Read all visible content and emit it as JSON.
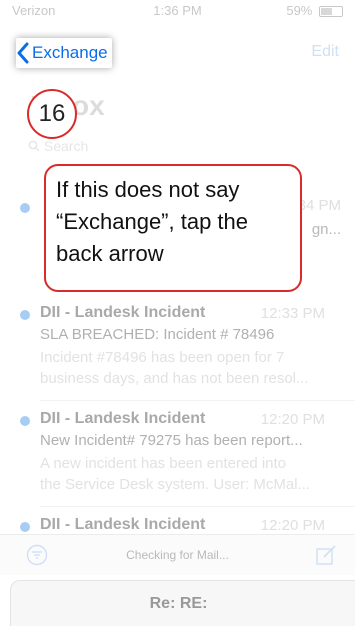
{
  "status_bar": {
    "carrier": "Verizon",
    "time": "1:36 PM",
    "battery": "59%"
  },
  "nav": {
    "back_label": "Exchange",
    "edit_label": "Edit"
  },
  "mailbox": {
    "title": "Inbox",
    "search_placeholder": "Search"
  },
  "messages": [
    {
      "sender": "",
      "time": "12:34 PM",
      "subject": "",
      "preview_tail_1": "gn...",
      "preview_tail_2": ""
    },
    {
      "sender": "DII - Landesk Incident",
      "time": "12:33 PM",
      "subject": "SLA BREACHED: Incident # 78496",
      "preview_1": "Incident #78496 has been open for 7",
      "preview_2": "business days, and has not been resol..."
    },
    {
      "sender": "DII - Landesk Incident",
      "time": "12:20 PM",
      "subject": "New Incident# 79275 has been report...",
      "preview_1": "A new incident has been entered into",
      "preview_2": "the Service Desk system. User: McMal..."
    },
    {
      "sender": "DII - Landesk Incident",
      "time": "12:20 PM"
    }
  ],
  "toolbar": {
    "status": "Checking for Mail..."
  },
  "draft": {
    "title": "Re: RE:"
  },
  "annotation": {
    "step_number": "16",
    "callout_text": "If this does not say “Exchange”, tap the back arrow"
  },
  "colors": {
    "accent": "#0a6ee8",
    "annotation_red": "#d92b2b",
    "unread_dot": "#a8cdf4"
  }
}
